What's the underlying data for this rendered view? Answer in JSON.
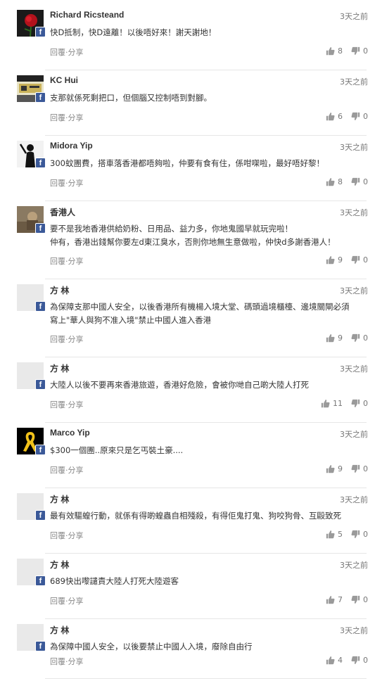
{
  "comments": [
    {
      "avatar": "rose",
      "name": "Richard Ricsteand",
      "time": "3天之前",
      "lines": [
        "快D抵制，快D遠離！以後唔好來！謝天謝地！"
      ],
      "likes": "8",
      "dislikes": "0"
    },
    {
      "avatar": "kc-hui",
      "name": "KC Hui",
      "time": "3天之前",
      "lines": [
        "支那就係死剩把口，但個腦又控制唔到對腳。"
      ],
      "likes": "6",
      "dislikes": "0"
    },
    {
      "avatar": "silhouette",
      "name": "Midora Yip",
      "time": "3天之前",
      "lines": [
        "300蚊團費，搭車落香港都唔夠啦，仲要有食有住，係咁㗎啦，最好唔好黎！"
      ],
      "likes": "8",
      "dislikes": "0"
    },
    {
      "avatar": "photo",
      "name": "香港人",
      "time": "3天之前",
      "lines": [
        "要不是我地香港供給奶粉、日用品、益力多，你地鬼國早就玩完啦！",
        "仲有，香港出錢幫你要左d東江臭水，否則你地無生意做啦，仲快d多謝香港人！"
      ],
      "likes": "9",
      "dislikes": "0"
    },
    {
      "avatar": "blank",
      "name": "方 林",
      "time": "3天之前",
      "lines": [
        "為保障支那中國人安全，以後香港所有機楊入境大堂、碼頭過境櫃檯、邊境關閘必須",
        "寫上\"華人與狗不准入境\"禁止中國人進入香港"
      ],
      "likes": "9",
      "dislikes": "0"
    },
    {
      "avatar": "blank",
      "name": "方 林",
      "time": "3天之前",
      "lines": [
        "大陸人以後不要再來香港旅遊，香港好危險，會被你哋自己啲大陸人打死"
      ],
      "likes": "11",
      "dislikes": "0"
    },
    {
      "avatar": "ribbon",
      "name": "Marco Yip",
      "time": "3天之前",
      "lines": [
        "$300一個團..原來只是乞丐裝土豪...."
      ],
      "likes": "9",
      "dislikes": "0"
    },
    {
      "avatar": "blank",
      "name": "方 林",
      "time": "3天之前",
      "lines": [
        "最有效驅蝗行動，就係有得啲蝗蟲自相殘殺，有得佢鬼打鬼、狗咬狗骨、互毆致死"
      ],
      "likes": "5",
      "dislikes": "0"
    },
    {
      "avatar": "blank",
      "name": "方 林",
      "time": "3天之前",
      "lines": [
        "689快出嚟譴責大陸人打死大陸遊客"
      ],
      "likes": "7",
      "dislikes": "0"
    },
    {
      "avatar": "blank",
      "name": "方 林",
      "time": "3天之前",
      "lines": [
        "為保障中國人安全，以後要禁止中國人入境，廢除自由行"
      ],
      "likes": "4",
      "dislikes": "0"
    }
  ],
  "actions": {
    "reply": "回覆",
    "separator": "·",
    "share": "分享"
  },
  "icons": {
    "like": "thumbs-up-icon",
    "dislike": "thumbs-down-icon",
    "badge": "facebook-icon"
  },
  "colors": {
    "facebook": "#3b5998",
    "text": "#333333",
    "muted": "#888888",
    "divider": "#e6e6e6"
  }
}
